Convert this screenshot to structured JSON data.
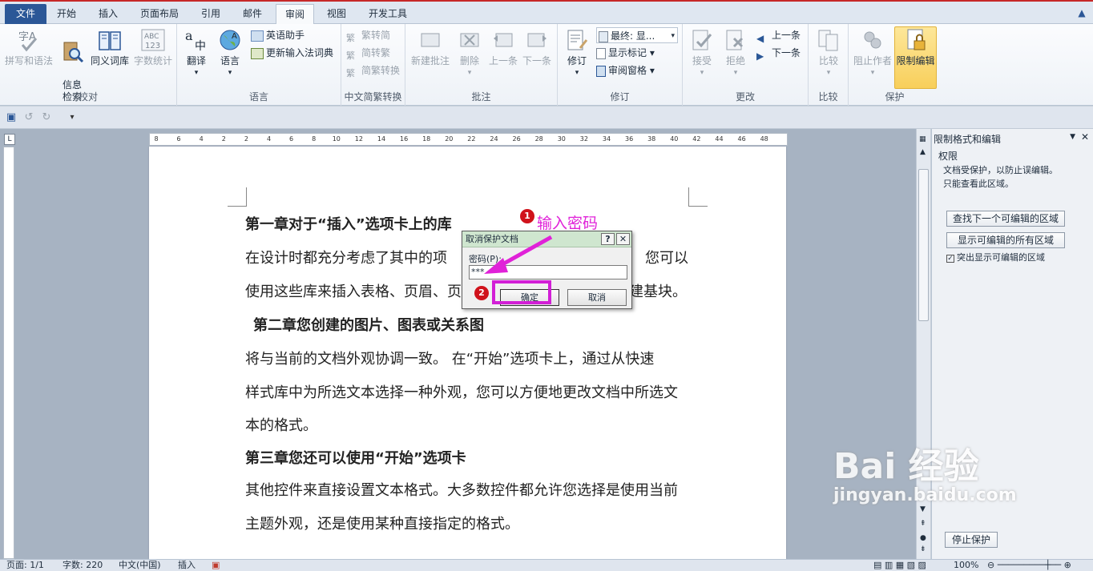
{
  "tabs": {
    "file": "文件",
    "home": "开始",
    "insert": "插入",
    "layout": "页面布局",
    "refs": "引用",
    "mail": "邮件",
    "review": "审阅",
    "view": "视图",
    "dev": "开发工具"
  },
  "ribbon": {
    "proof": {
      "spell": "拼写和语法",
      "info": "信息\n检索",
      "thesaurus": "同义词库",
      "wordcount": "字数统计",
      "label": "校对"
    },
    "lang": {
      "translate": "翻译",
      "language": "语言",
      "eng_assist": "英语助手",
      "update_ime": "更新输入法词典",
      "label": "语言"
    },
    "chinese": {
      "t2s": "繁转简",
      "s2t": "简转繁",
      "conv": "简繁转换",
      "label": "中文简繁转换"
    },
    "comments": {
      "new": "新建批注",
      "delete": "删除",
      "prev": "上一条",
      "next": "下一条",
      "label": "批注"
    },
    "tracking": {
      "track": "修订",
      "final": "最终: 显...",
      "show_markup": "显示标记",
      "review_pane": "审阅窗格",
      "label": "修订"
    },
    "changes": {
      "accept": "接受",
      "reject": "拒绝",
      "prev": "上一条",
      "next": "下一条",
      "label": "更改"
    },
    "compare": {
      "compare": "比较",
      "label": "比较"
    },
    "protect": {
      "block_authors": "阻止作者",
      "restrict": "限制编辑",
      "label": "保护"
    }
  },
  "ruler_ticks": [
    "8",
    "6",
    "4",
    "2",
    "2",
    "4",
    "6",
    "8",
    "10",
    "12",
    "14",
    "16",
    "18",
    "20",
    "22",
    "24",
    "26",
    "28",
    "30",
    "32",
    "34",
    "36",
    "38",
    "40",
    "42",
    "44",
    "46",
    "48"
  ],
  "doc": {
    "p1": "第一章对于“插入”选项卡上的库",
    "p2": "在设计时都充分考虑了其中的项",
    "p2b": "您可以",
    "p3": "使用这些库来插入表格、页眉、页",
    "p3b": "建基块。",
    "p4": "第二章您创建的图片、图表或关系图",
    "p5": "将与当前的文档外观协调一致。  在“开始”选项卡上，通过从快速",
    "p6": "样式库中为所选文本选择一种外观，您可以方便地更改文档中所选文",
    "p7": "本的格式。",
    "p8": "第三章您还可以使用“开始”选项卡",
    "p9": "其他控件来直接设置文本格式。大多数控件都允许您选择是使用当前",
    "p10": "主题外观，还是使用某种直接指定的格式。"
  },
  "dialog": {
    "title": "取消保护文档",
    "help": "?",
    "close": "✕",
    "password_label": "密码(P):",
    "password_value": "***",
    "ok": "确定",
    "cancel": "取消"
  },
  "annotations": {
    "step1": "1",
    "step1_text": "输入密码",
    "step2": "2"
  },
  "pane": {
    "title": "限制格式和编辑",
    "section": "权限",
    "desc1": "文档受保护，以防止误编辑。",
    "desc2": "只能查看此区域。",
    "find_next": "查找下一个可编辑的区域",
    "show_all": "显示可编辑的所有区域",
    "highlight": "突出显示可编辑的区域",
    "stop": "停止保护"
  },
  "status": {
    "page": "页面: 1/1",
    "words": "字数: 220",
    "lang": "中文(中国)",
    "mode": "插入",
    "zoom": "100%"
  },
  "watermark": {
    "brand": "Bai  经验",
    "url": "jingyan.baidu.com"
  }
}
